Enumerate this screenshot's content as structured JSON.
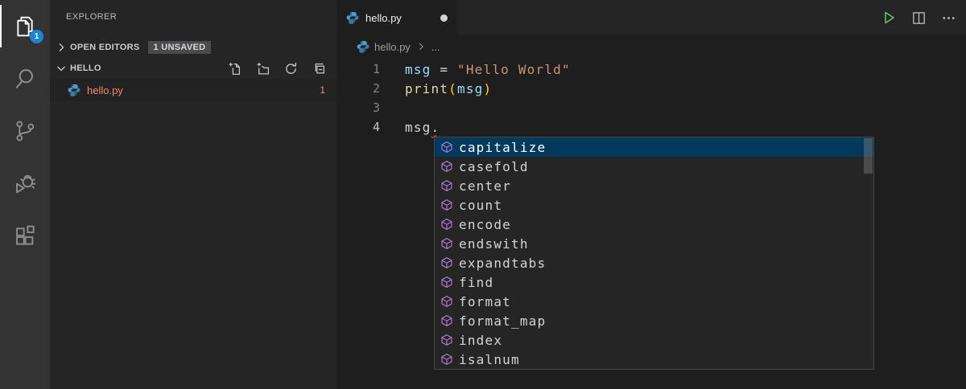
{
  "activity_bar": {
    "badge_count": "1",
    "items": [
      {
        "name": "explorer",
        "icon": "files-icon",
        "active": true
      },
      {
        "name": "search",
        "icon": "search-icon",
        "active": false
      },
      {
        "name": "source-control",
        "icon": "source-control-icon",
        "active": false
      },
      {
        "name": "run-debug",
        "icon": "debug-icon",
        "active": false
      },
      {
        "name": "extensions",
        "icon": "extensions-icon",
        "active": false
      }
    ]
  },
  "sidebar": {
    "title": "EXPLORER",
    "open_editors": {
      "label": "OPEN EDITORS",
      "badge": "1 UNSAVED"
    },
    "folder": {
      "name": "HELLO",
      "actions": [
        "new-file-icon",
        "new-folder-icon",
        "refresh-icon",
        "collapse-all-icon"
      ]
    },
    "files": [
      {
        "name": "hello.py",
        "icon": "python-icon",
        "problem_count": "1"
      }
    ]
  },
  "editor": {
    "tab": {
      "label": "hello.py",
      "modified_dot": "unsaved"
    },
    "actions": [
      "run-icon",
      "split-editor-icon",
      "more-actions-icon"
    ],
    "breadcrumb": {
      "file": "hello.py",
      "more": "..."
    },
    "code": {
      "lines": [
        {
          "number": "1",
          "active": false,
          "tokens": [
            {
              "t": "msg",
              "c": "variable"
            },
            {
              "t": " = ",
              "c": "plain"
            },
            {
              "t": "\"Hello World\"",
              "c": "string"
            }
          ]
        },
        {
          "number": "2",
          "active": false,
          "tokens": [
            {
              "t": "print",
              "c": "function"
            },
            {
              "t": "(",
              "c": "bracket"
            },
            {
              "t": "msg",
              "c": "variable"
            },
            {
              "t": ")",
              "c": "bracket"
            }
          ]
        },
        {
          "number": "3",
          "active": false,
          "tokens": []
        },
        {
          "number": "4",
          "active": true,
          "tokens": [
            {
              "t": "msg",
              "c": "plain"
            },
            {
              "t": ".",
              "c": "plain",
              "squiggle": true
            }
          ]
        }
      ]
    },
    "suggestions": {
      "selected_index": 0,
      "item_icon": "symbol-method-icon",
      "items": [
        "capitalize",
        "casefold",
        "center",
        "count",
        "encode",
        "endswith",
        "expandtabs",
        "find",
        "format",
        "format_map",
        "index",
        "isalnum"
      ]
    }
  },
  "colors": {
    "activity_badge_blue": "#1a85d2",
    "error_red": "#f48771",
    "squiggle_red": "#f14c4c",
    "selected_suggestion_blue": "#04395e",
    "method_icon_purple": "#b180d7",
    "run_green": "#6fc26f",
    "string_orange": "#ce9178",
    "variable_blue": "#9cdcfe",
    "function_yellow": "#dcdcaa",
    "bracket_gold": "#ffd700"
  }
}
